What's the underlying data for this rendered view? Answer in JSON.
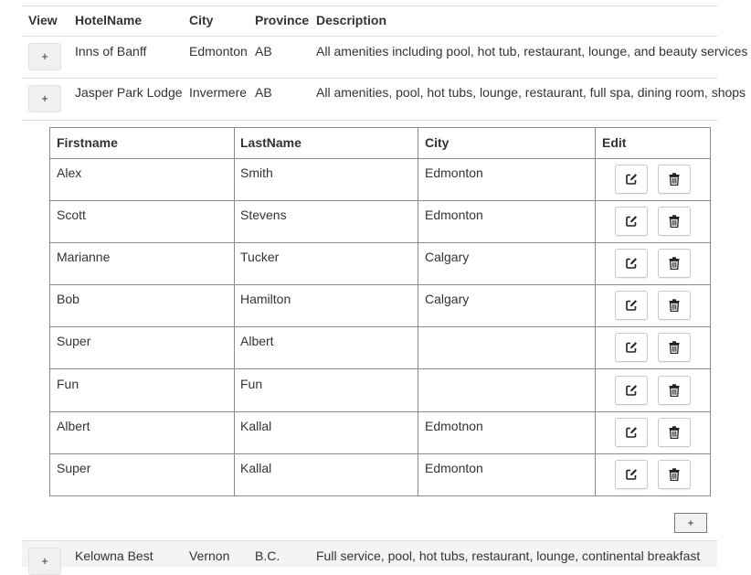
{
  "table": {
    "headers": {
      "view": "View",
      "hotel": "HotelName",
      "city": "City",
      "province": "Province",
      "description": "Description"
    },
    "rows": [
      {
        "expand": "+",
        "hotel": "Inns of Banff",
        "city": "Edmonton",
        "province": "AB",
        "description": "All amenities including pool, hot tub, restaurant, lounge, and beauty services"
      },
      {
        "expand": "+",
        "hotel": "Jasper Park Lodge",
        "city": "Invermere",
        "province": "AB",
        "description": "All amenities, pool, hot tubs, lounge, restaurant, full spa, dining room, shops"
      },
      {
        "expand": "+",
        "hotel": "Kelowna Best",
        "city": "Vernon",
        "province": "B.C.",
        "description": "Full service, pool, hot tubs, restaurant, lounge, continental breakfast"
      }
    ]
  },
  "guests": {
    "headers": {
      "firstname": "Firstname",
      "lastname": "LastName",
      "city": "City",
      "edit": "Edit"
    },
    "rows": [
      {
        "firstname": "Alex",
        "lastname": "Smith",
        "city": "Edmonton"
      },
      {
        "firstname": "Scott",
        "lastname": "Stevens",
        "city": "Edmonton"
      },
      {
        "firstname": "Marianne",
        "lastname": "Tucker",
        "city": "Calgary"
      },
      {
        "firstname": "Bob",
        "lastname": "Hamilton",
        "city": "Calgary"
      },
      {
        "firstname": "Super",
        "lastname": "Albert",
        "city": ""
      },
      {
        "firstname": "Fun",
        "lastname": "Fun",
        "city": ""
      },
      {
        "firstname": "Albert",
        "lastname": "Kallal",
        "city": "Edmotnon"
      },
      {
        "firstname": "Super",
        "lastname": "Kallal",
        "city": "Edmonton"
      }
    ],
    "row_icons": {
      "edit": "edit-icon",
      "delete": "trash-icon"
    },
    "add_label": "+"
  }
}
